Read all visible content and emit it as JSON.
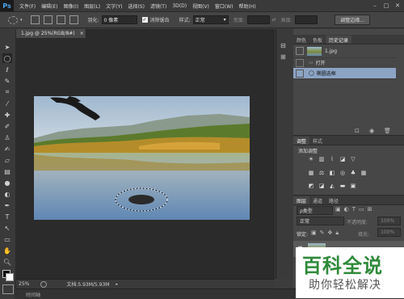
{
  "app": {
    "logo": "Ps"
  },
  "menu": [
    "文件(F)",
    "编辑(E)",
    "图像(I)",
    "图层(L)",
    "文字(Y)",
    "选择(S)",
    "滤镜(T)",
    "3D(D)",
    "视图(V)",
    "窗口(W)",
    "帮助(H)"
  ],
  "window_controls": {
    "minimize": "–",
    "maximize": "□",
    "close": "✕"
  },
  "options": {
    "feather_label": "羽化:",
    "feather_value": "0 像素",
    "antialias_label": "消除锯齿",
    "style_label": "样式:",
    "style_value": "正常",
    "width_label": "宽度:",
    "height_label": "高度:",
    "refine_button": "调整边缘..."
  },
  "document": {
    "tab_title": "1.jpg @ 25%(RGB/8#)",
    "tab_close": "×",
    "zoom": "25%",
    "doc_size": "文档:5.93M/5.93M"
  },
  "timeline": {
    "label": "时间轴"
  },
  "history_panel": {
    "tabs": [
      "颜色",
      "色板",
      "历史记录"
    ],
    "snapshot_name": "1.jpg",
    "items": [
      "打开",
      "椭圆选框"
    ]
  },
  "adjustments_panel": {
    "tabs": [
      "调整",
      "样式"
    ],
    "title": "添加调整"
  },
  "layers_panel": {
    "tabs": [
      "图层",
      "通道",
      "路径"
    ],
    "filter_value": "ρ类型",
    "blend_mode": "正常",
    "opacity_label": "不透明度:",
    "opacity_value": "100%",
    "lock_label": "锁定:",
    "fill_label": "填充:",
    "fill_value": "100%"
  },
  "watermark": {
    "title": "百科全说",
    "subtitle": "助你轻松解决"
  },
  "colors": {
    "accent": "#8ca4c4",
    "watermark_green": "#2f8a3a"
  }
}
